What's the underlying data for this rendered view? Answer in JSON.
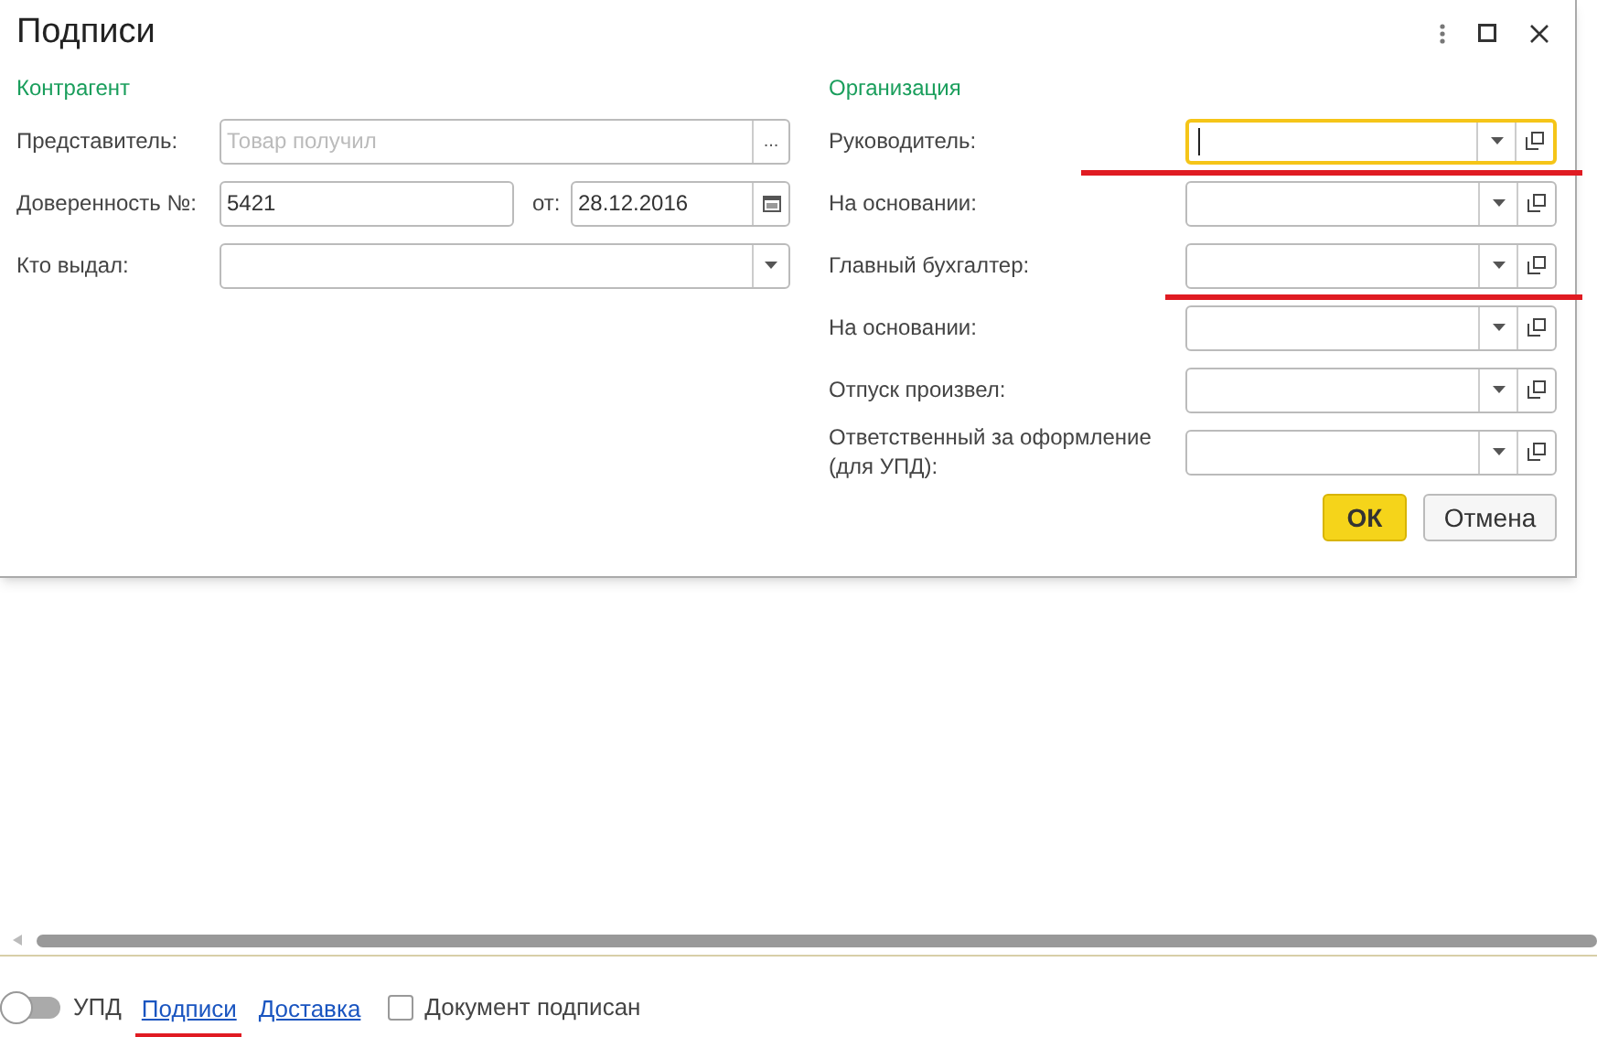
{
  "dialog": {
    "title": "Подписи",
    "left": {
      "heading": "Контрагент",
      "representative": {
        "label": "Представитель:",
        "placeholder": "Товар получил",
        "select_button": "..."
      },
      "proxy": {
        "label": "Доверенность №:",
        "value": "5421",
        "date_label": "от:",
        "date": "28.12.2016"
      },
      "issued_by": {
        "label": "Кто выдал:"
      }
    },
    "right": {
      "heading": "Организация",
      "fields": [
        {
          "label": "Руководитель:",
          "focused": true,
          "underlined": true
        },
        {
          "label": "На основании:",
          "focused": false,
          "underlined": false
        },
        {
          "label": "Главный бухгалтер:",
          "focused": false,
          "underlined": true
        },
        {
          "label": "На основании:",
          "focused": false,
          "underlined": false
        },
        {
          "label": "Отпуск произвел:",
          "focused": false,
          "underlined": false
        },
        {
          "label": "Ответственный за оформление (для УПД):",
          "focused": false,
          "underlined": false
        }
      ]
    },
    "buttons": [
      {
        "label": "ОК",
        "kind": "primary"
      },
      {
        "label": "Отмена",
        "kind": "secondary"
      }
    ]
  },
  "footer": {
    "toggle": {
      "label": "УПД",
      "on": false
    },
    "links": [
      {
        "label": "Подписи",
        "underlined": true
      },
      {
        "label": "Доставка",
        "underlined": false
      }
    ],
    "checkbox": {
      "label": "Документ подписан",
      "checked": false
    }
  }
}
